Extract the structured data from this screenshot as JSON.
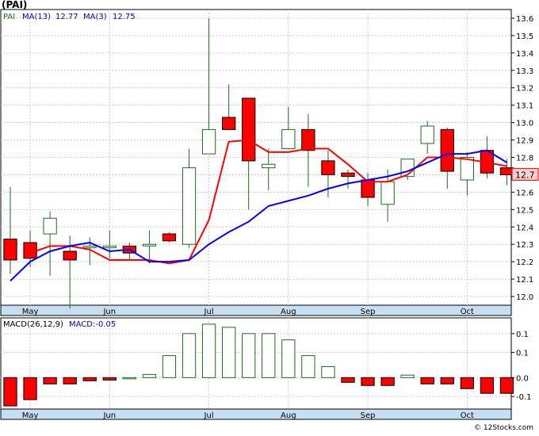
{
  "ticker_title": "(PAI)",
  "copyright": "© 12Stocks.com",
  "colors": {
    "up_candle": "#1a6e1a",
    "down_candle": "#ff0000",
    "wick": "#1a6e1a",
    "ma_long": "#0000ff",
    "ma_short": "#ff0000",
    "grid": "#c8c8c8",
    "panel_border": "#000000",
    "axis_band": "#c6dff2",
    "last_price_box": "#ffd0d0",
    "legend_text": "#0000cc"
  },
  "chart_data": [
    {
      "type": "candlestick",
      "legend": {
        "symbol": "PAI",
        "ma13_label": "MA(13)",
        "ma13_value": "12.77",
        "ma3_label": "MA(3)",
        "ma3_value": "12.75"
      },
      "x_labels": [
        {
          "label": "May",
          "index": 1
        },
        {
          "label": "Jun",
          "index": 5
        },
        {
          "label": "Jul",
          "index": 10
        },
        {
          "label": "Aug",
          "index": 14
        },
        {
          "label": "Sep",
          "index": 18
        },
        {
          "label": "Oct",
          "index": 23
        }
      ],
      "y_ticks": [
        "13.6",
        "13.5",
        "13.4",
        "13.3",
        "13.2",
        "13.1",
        "13.0",
        "12.9",
        "12.8",
        "12.7",
        "12.6",
        "12.5",
        "12.4",
        "12.3",
        "12.2",
        "12.1",
        "12.0"
      ],
      "ylim": [
        11.95,
        13.65
      ],
      "last_price": "12.7",
      "last_price_value": 12.7,
      "grid": true,
      "candles": [
        {
          "o": 12.33,
          "h": 12.63,
          "l": 12.13,
          "c": 12.21
        },
        {
          "o": 12.31,
          "h": 12.38,
          "l": 12.17,
          "c": 12.22
        },
        {
          "o": 12.36,
          "h": 12.49,
          "l": 12.12,
          "c": 12.45
        },
        {
          "o": 12.26,
          "h": 12.35,
          "l": 11.93,
          "c": 12.21
        },
        {
          "o": 12.29,
          "h": 12.34,
          "l": 12.18,
          "c": 12.29
        },
        {
          "o": 12.29,
          "h": 12.38,
          "l": 12.22,
          "c": 12.29
        },
        {
          "o": 12.29,
          "h": 12.31,
          "l": 12.21,
          "c": 12.25
        },
        {
          "o": 12.3,
          "h": 12.38,
          "l": 12.19,
          "c": 12.3
        },
        {
          "o": 12.36,
          "h": 12.37,
          "l": 12.31,
          "c": 12.32
        },
        {
          "o": 12.3,
          "h": 12.85,
          "l": 12.28,
          "c": 12.74
        },
        {
          "o": 12.82,
          "h": 13.6,
          "l": 12.82,
          "c": 12.96
        },
        {
          "o": 13.03,
          "h": 13.22,
          "l": 12.96,
          "c": 12.96
        },
        {
          "o": 13.14,
          "h": 13.14,
          "l": 12.5,
          "c": 12.78
        },
        {
          "o": 12.74,
          "h": 12.85,
          "l": 12.61,
          "c": 12.76
        },
        {
          "o": 12.85,
          "h": 13.09,
          "l": 12.85,
          "c": 12.96
        },
        {
          "o": 12.96,
          "h": 13.05,
          "l": 12.63,
          "c": 12.84
        },
        {
          "o": 12.78,
          "h": 12.84,
          "l": 12.57,
          "c": 12.7
        },
        {
          "o": 12.71,
          "h": 12.73,
          "l": 12.62,
          "c": 12.69
        },
        {
          "o": 12.67,
          "h": 12.71,
          "l": 12.52,
          "c": 12.57
        },
        {
          "o": 12.53,
          "h": 12.73,
          "l": 12.43,
          "c": 12.66
        },
        {
          "o": 12.69,
          "h": 12.78,
          "l": 12.67,
          "c": 12.79
        },
        {
          "o": 12.88,
          "h": 13.01,
          "l": 12.82,
          "c": 12.98
        },
        {
          "o": 12.96,
          "h": 12.97,
          "l": 12.62,
          "c": 12.72
        },
        {
          "o": 12.67,
          "h": 12.83,
          "l": 12.58,
          "c": 12.8
        },
        {
          "o": 12.84,
          "h": 12.92,
          "l": 12.68,
          "c": 12.71
        },
        {
          "o": 12.74,
          "h": 12.79,
          "l": 12.64,
          "c": 12.7
        }
      ],
      "ma13": [
        12.09,
        12.2,
        12.26,
        12.29,
        12.31,
        12.26,
        12.27,
        12.2,
        12.2,
        12.21,
        12.3,
        12.37,
        12.43,
        12.52,
        12.55,
        12.58,
        12.62,
        12.65,
        12.67,
        12.69,
        12.72,
        12.77,
        12.82,
        12.82,
        12.84,
        12.77
      ],
      "ma3": [
        null,
        12.25,
        12.29,
        12.29,
        12.27,
        12.21,
        12.21,
        12.21,
        12.19,
        12.21,
        12.44,
        12.89,
        12.9,
        12.83,
        12.83,
        12.85,
        12.85,
        12.76,
        12.66,
        12.66,
        12.7,
        12.8,
        12.8,
        12.79,
        12.77,
        12.75
      ]
    },
    {
      "type": "bar",
      "legend": {
        "label": "MACD(26,12,9)",
        "value_label": "MACD:-0.05"
      },
      "x_labels": [
        "May",
        "Jun",
        "Jul",
        "Aug",
        "Sep",
        "Oct"
      ],
      "y_ticks": [
        "0.1",
        "0.1",
        "0.0",
        "-0.1"
      ],
      "y_tick_values": [
        0.14,
        0.08,
        0.0,
        -0.06
      ],
      "ylim": [
        -0.1,
        0.19
      ],
      "values": [
        -0.09,
        -0.07,
        -0.02,
        -0.02,
        -0.01,
        -0.008,
        0.0,
        0.01,
        0.07,
        0.14,
        0.17,
        0.16,
        0.14,
        0.14,
        0.12,
        0.07,
        0.035,
        -0.015,
        -0.025,
        -0.025,
        0.008,
        -0.02,
        -0.02,
        -0.035,
        -0.05,
        -0.05
      ]
    }
  ]
}
